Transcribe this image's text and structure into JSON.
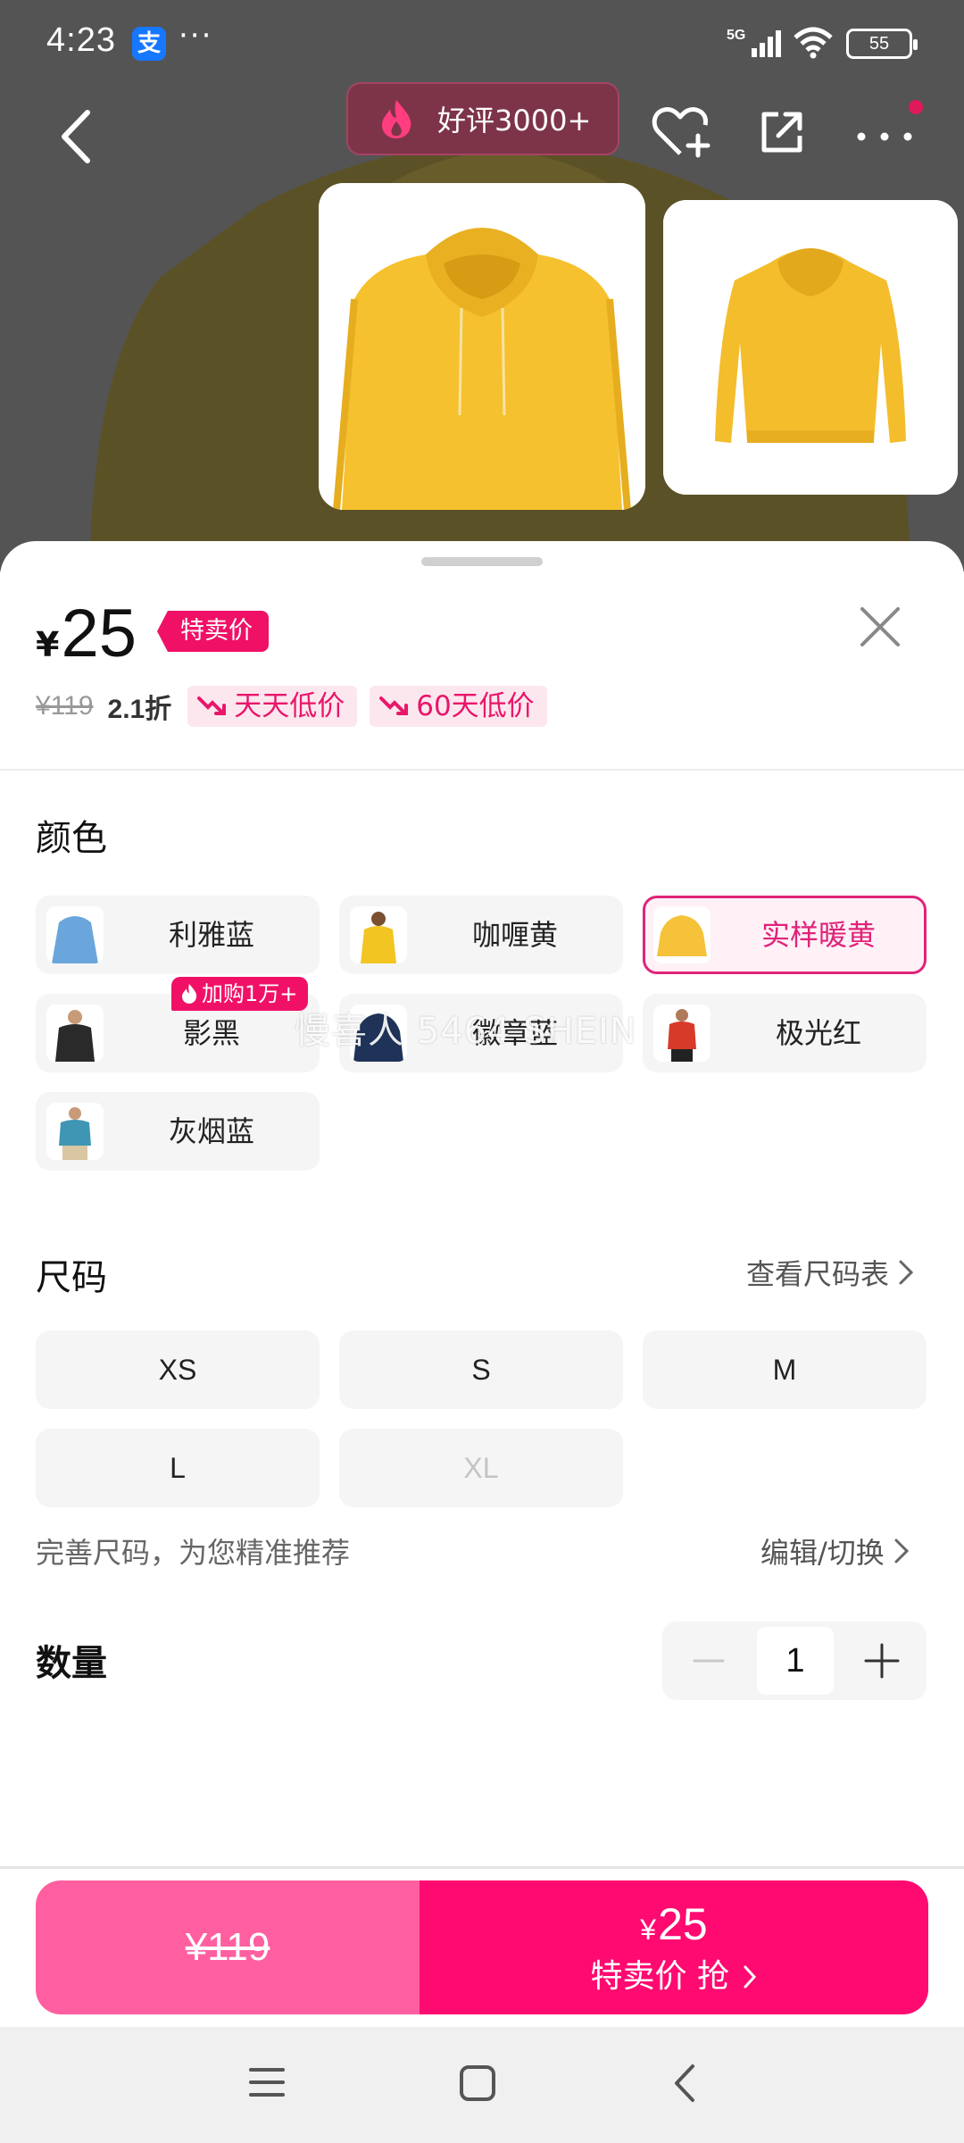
{
  "status_bar": {
    "time": "4:23",
    "more": "···",
    "network": "5G",
    "battery": "55"
  },
  "header": {
    "rating_label": "好评3000+"
  },
  "price": {
    "currency": "¥",
    "current": "25",
    "special_tag": "特卖价",
    "original": "¥119",
    "discount": "2.1折",
    "badges": [
      "天天低价",
      "60天低价"
    ]
  },
  "colors": {
    "title": "颜色",
    "options": [
      {
        "label": "利雅蓝",
        "swatch": "#6aa6dc",
        "selected": false
      },
      {
        "label": "咖喱黄",
        "swatch": "#f2c522",
        "selected": false
      },
      {
        "label": "实样暖黄",
        "swatch": "#f5c23a",
        "selected": true
      },
      {
        "label": "影黑",
        "swatch": "#2a2a2a",
        "selected": false
      },
      {
        "label": "徽章蓝",
        "swatch": "#1f3358",
        "selected": false
      },
      {
        "label": "极光红",
        "swatch": "#d83a2a",
        "selected": false
      },
      {
        "label": "灰烟蓝",
        "swatch": "#3f95b4",
        "selected": false
      }
    ],
    "hot_badge": "加购1万+",
    "watermark": "慢喜人 5464 SHEIN"
  },
  "size": {
    "title": "尺码",
    "chart_link": "查看尺码表",
    "options": [
      {
        "label": "XS",
        "available": true
      },
      {
        "label": "S",
        "available": true
      },
      {
        "label": "M",
        "available": true
      },
      {
        "label": "L",
        "available": true
      },
      {
        "label": "XL",
        "available": false
      }
    ],
    "hint": "完善尺码，为您精准推荐",
    "edit_link": "编辑/切换"
  },
  "quantity": {
    "title": "数量",
    "value": "1"
  },
  "cta": {
    "original_price": "¥119",
    "currency": "¥",
    "price": "25",
    "label": "特卖价 抢"
  },
  "theme": {
    "accent": "#f01167",
    "cta_left": "#ff5fa0",
    "cta_right": "#ff0a70",
    "hoodie": "#f6c12e"
  }
}
